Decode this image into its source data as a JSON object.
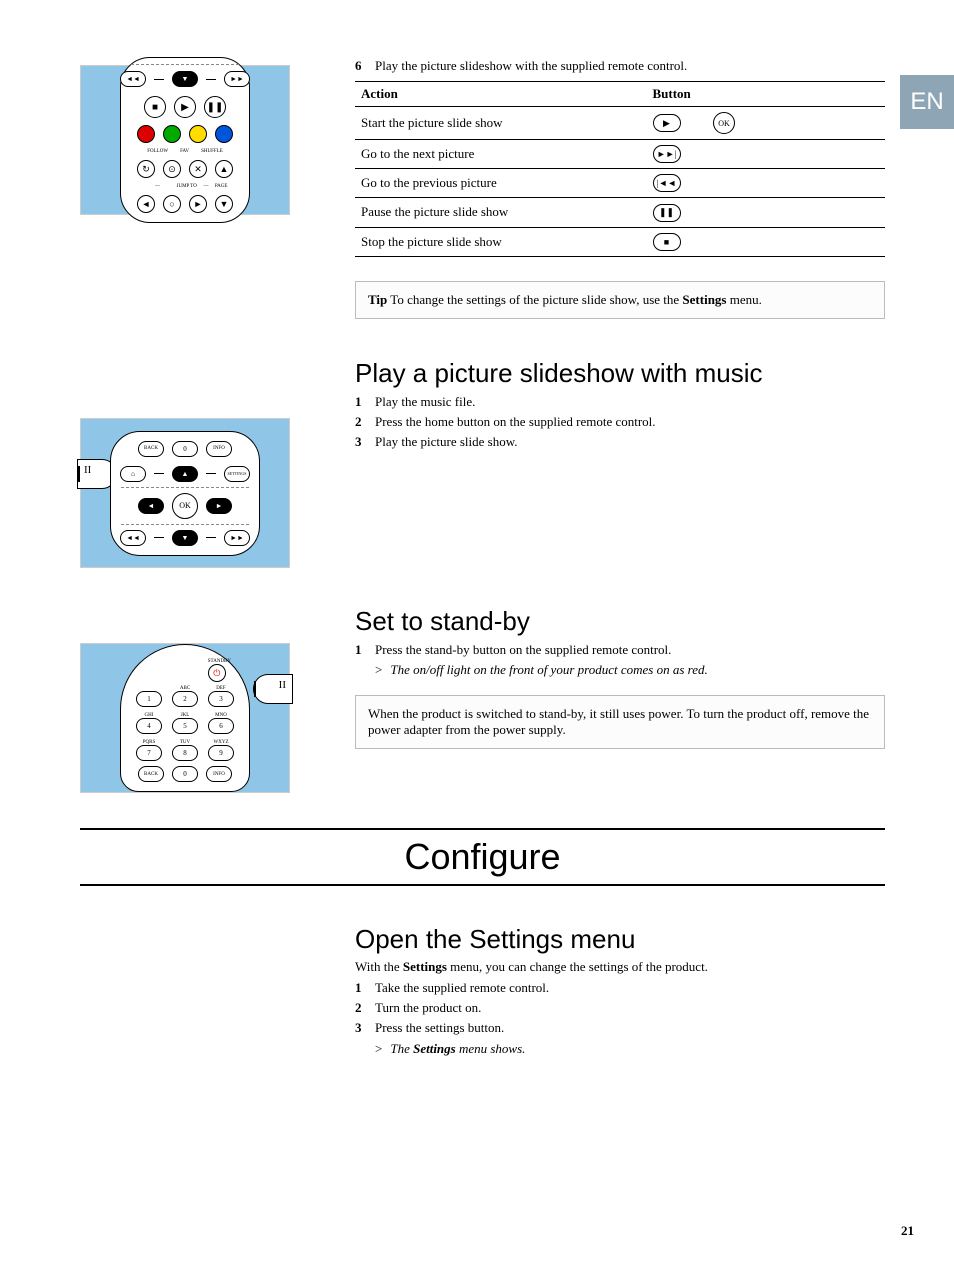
{
  "lang": "EN",
  "step6": {
    "num": "6",
    "text": "Play the picture slideshow with the supplied remote control."
  },
  "table": {
    "headers": {
      "action": "Action",
      "button": "Button"
    },
    "rows": [
      {
        "action": "Start the picture slide show"
      },
      {
        "action": "Go to the next picture"
      },
      {
        "action": "Go to the previous picture"
      },
      {
        "action": "Pause the picture slide show"
      },
      {
        "action": "Stop the picture slide show"
      }
    ]
  },
  "tip": {
    "label": "Tip",
    "text_before": " To change the settings of the picture slide show, use the ",
    "bold": "Settings",
    "text_after": " menu."
  },
  "section_music": {
    "title": "Play a picture slideshow with music",
    "steps": [
      {
        "n": "1",
        "t": "Play the music file."
      },
      {
        "n": "2",
        "t": "Press the home button on the supplied remote control."
      },
      {
        "n": "3",
        "t": "Play the picture slide show."
      }
    ]
  },
  "section_standby": {
    "title": "Set to stand-by",
    "steps": [
      {
        "n": "1",
        "t": "Press the stand-by button on the supplied remote control."
      }
    ],
    "result": "The on/off light on the front of your product comes on as red.",
    "note": "When the product is switched to stand-by, it still uses power. To turn the product off, remove the power adapter from the power supply."
  },
  "chapter": "Configure",
  "section_settings": {
    "title": "Open the Settings menu",
    "intro_before": "With the ",
    "intro_bold": "Settings",
    "intro_after": " menu, you can change the settings of the product.",
    "steps": [
      {
        "n": "1",
        "t": "Take the supplied remote control."
      },
      {
        "n": "2",
        "t": "Turn the product on."
      },
      {
        "n": "3",
        "t": "Press the settings button."
      }
    ],
    "result_before": "The ",
    "result_bold": "Settings",
    "result_after": " menu shows."
  },
  "page_number": "21",
  "remote_labels": {
    "follow": "FOLLOW",
    "fav": "FAV",
    "shuffle": "SHUFFLE",
    "jumpto": "JUMP TO",
    "page": "PAGE",
    "back": "BACK",
    "info": "INFO",
    "settings": "SETTINGS",
    "ok": "OK",
    "standby": "STANDBY",
    "abc": "ABC",
    "def": "DEF",
    "ghi": "GHI",
    "jkl": "JKL",
    "mno": "MNO",
    "pqrs": "PQRS",
    "tuv": "TUV",
    "wxyz": "WXYZ"
  }
}
